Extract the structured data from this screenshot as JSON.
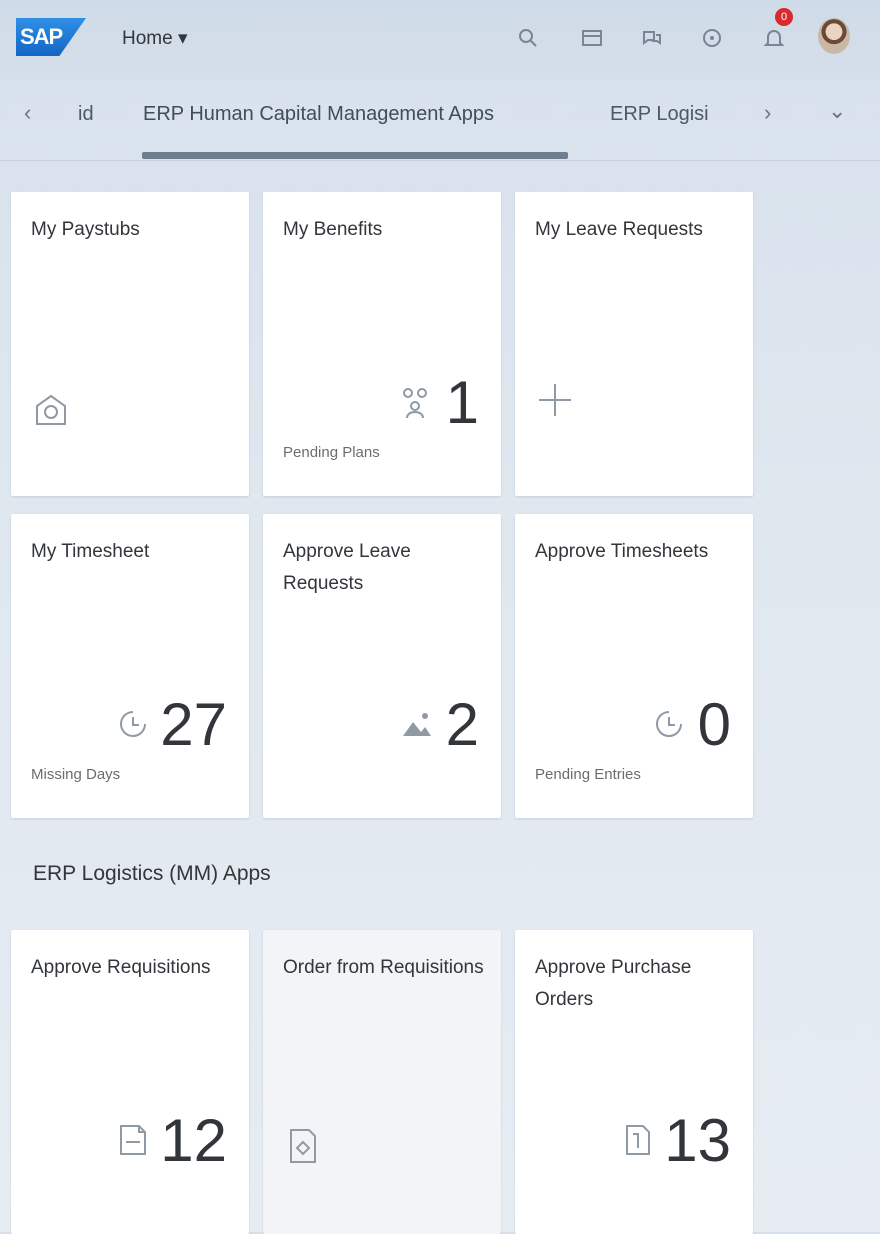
{
  "shell": {
    "logo": "SAP",
    "home_label": "Home ▾",
    "notification_count": "0"
  },
  "tabs": {
    "items": [
      {
        "label": "id"
      },
      {
        "label": "ERP Human Capital Management Apps"
      },
      {
        "label": "ERP Logisi"
      }
    ],
    "active_index": 1,
    "prev_arrow": "‹",
    "next_arrow": "›",
    "overflow": "⌄"
  },
  "groups": [
    {
      "title": "",
      "tiles": [
        {
          "title": "My Paystubs",
          "kpi": "",
          "footer": "",
          "icon": "paystub-icon"
        },
        {
          "title": "My Benefits",
          "kpi": "1",
          "footer": "Pending Plans",
          "icon": "benefits-icon"
        },
        {
          "title": "My Leave Requests",
          "kpi": "",
          "footer": "",
          "icon": "add-icon"
        },
        {
          "title": "My Timesheet",
          "kpi": "27",
          "footer": "Missing Days",
          "icon": "timesheet-icon"
        },
        {
          "title": "Approve Leave Requests",
          "kpi": "2",
          "footer": "",
          "icon": "leave-icon"
        },
        {
          "title": "Approve Timesheets",
          "kpi": "0",
          "footer": "Pending Entries",
          "icon": "timesheet-icon"
        }
      ]
    },
    {
      "title": "ERP Logistics (MM) Apps",
      "tiles": [
        {
          "title": "Approve Requisitions",
          "kpi": "12",
          "footer": "",
          "icon": "requisition-icon"
        },
        {
          "title": "Order from Requisitions",
          "kpi": "",
          "footer": "",
          "icon": "order-icon"
        },
        {
          "title": "Approve Purchase Orders",
          "kpi": "13",
          "footer": "",
          "icon": "purchase-order-icon"
        }
      ]
    }
  ],
  "colors": {
    "accent": "#1466c4",
    "badge": "#d92b2b",
    "tile_bg": "#ffffff"
  }
}
